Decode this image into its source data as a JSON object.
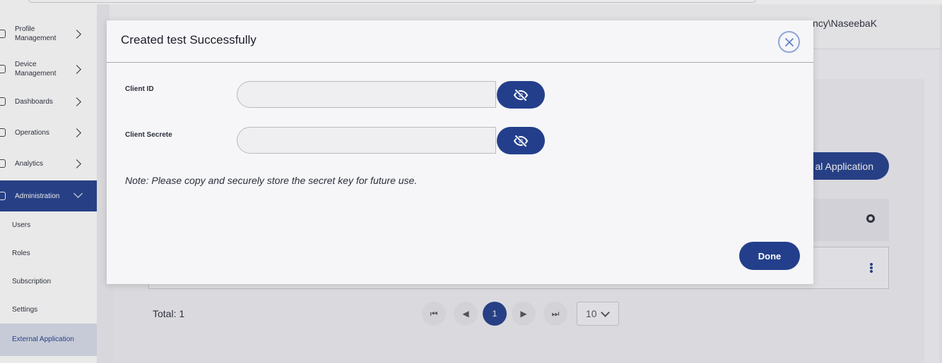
{
  "header": {
    "user": "ncy\\NaseebaK"
  },
  "sidebar": {
    "items": [
      {
        "label": "Profile Management"
      },
      {
        "label": "Device Management"
      },
      {
        "label": "Dashboards"
      },
      {
        "label": "Operations"
      },
      {
        "label": "Analytics"
      },
      {
        "label": "Administration"
      }
    ],
    "subitems": [
      {
        "label": "Users"
      },
      {
        "label": "Roles"
      },
      {
        "label": "Subscription"
      },
      {
        "label": "Settings"
      },
      {
        "label": "External Application"
      }
    ]
  },
  "page": {
    "create_button": "al Application",
    "total": "Total: 1",
    "current_page": "1",
    "page_size": "10"
  },
  "modal": {
    "title": "Created test Successfully",
    "close_icon": "close-icon",
    "client_id_label": "Client ID",
    "client_id_value": "",
    "client_secret_label": "Client Secrete",
    "client_secret_value": "",
    "visibility_icon": "eye-off-icon",
    "note": "Note: Please copy and securely store the secret key for future use.",
    "done_label": "Done"
  },
  "colors": {
    "primary": "#233f8c",
    "close_ring": "#8fa6d6"
  }
}
